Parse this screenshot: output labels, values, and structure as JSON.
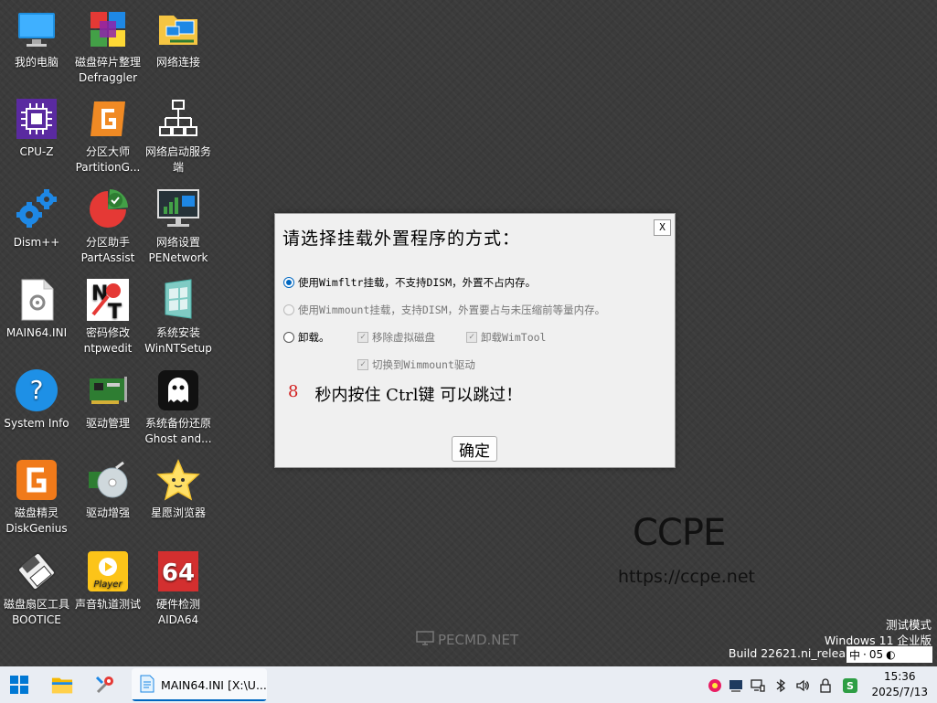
{
  "desktop_icons": [
    {
      "label": "我的电脑",
      "icon": "computer-icon"
    },
    {
      "label": "磁盘碎片整理",
      "label2": "Defraggler",
      "icon": "defrag-icon"
    },
    {
      "label": "网络连接",
      "icon": "network-folder-icon"
    },
    {
      "label": "CPU-Z",
      "icon": "cpuz-icon"
    },
    {
      "label": "分区大师",
      "label2": "PartitionG...",
      "icon": "partition-master-icon"
    },
    {
      "label": "网络启动服务",
      "label2": "端",
      "icon": "network-boot-icon"
    },
    {
      "label": "Dism++",
      "icon": "gears-icon"
    },
    {
      "label": "分区助手",
      "label2": "PartAssist",
      "icon": "part-assist-icon"
    },
    {
      "label": "网络设置",
      "label2": "PENetwork",
      "icon": "network-monitor-icon"
    },
    {
      "label": "MAIN64.INI",
      "icon": "ini-file-icon"
    },
    {
      "label": "密码修改",
      "label2": "ntpwedit",
      "icon": "nt-password-icon"
    },
    {
      "label": "系统安装",
      "label2": "WinNTSetup",
      "icon": "winntsetup-icon"
    },
    {
      "label": "System Info",
      "icon": "help-icon"
    },
    {
      "label": "驱动管理",
      "icon": "driver-card-icon"
    },
    {
      "label": "系统备份还原",
      "label2": "Ghost and...",
      "icon": "ghost-icon"
    },
    {
      "label": "磁盘精灵",
      "label2": "DiskGenius",
      "icon": "diskgenius-icon"
    },
    {
      "label": "驱动增强",
      "icon": "driver-cd-icon"
    },
    {
      "label": "星愿浏览器",
      "icon": "star-browser-icon"
    },
    {
      "label": "磁盘扇区工具",
      "label2": "BOOTICE",
      "icon": "bootice-icon"
    },
    {
      "label": "声音轨道测试",
      "icon": "player-icon"
    },
    {
      "label": "硬件检测",
      "label2": "AIDA64",
      "icon": "aida64-icon"
    }
  ],
  "watermark": {
    "brand": "CCPE",
    "url": "https://ccpe.net",
    "pecmd": "PECMD.NET",
    "mode": "测试模式",
    "os": "Windows 11 企业版",
    "build": "Build 22621.ni_relea",
    "build_tail": "05"
  },
  "dialog": {
    "close": "X",
    "title": "请选择挂载外置程序的方式：",
    "option1": "使用Wimfltr挂载，不支持DISM，外置不占内存。",
    "option2": "使用Wimmount挂载，支持DISM，外置要占与未压缩前等量内存。",
    "option3": "卸载。",
    "check1": "移除虚拟磁盘",
    "check2": "卸载WimTool",
    "check3": "切换到Wimmount驱动",
    "countdown_num": "8",
    "countdown_text": "秒内按住 Ctrl键 可以跳过！",
    "ok": "确定"
  },
  "taskbar": {
    "task_label": "MAIN64.INI [X:\\U...",
    "ime": "中",
    "time": "15:36",
    "date": "2025/7/13"
  },
  "colors": {
    "accent": "#0067c0",
    "countdown": "#d21f1f",
    "taskbar": "#e9edf3"
  }
}
